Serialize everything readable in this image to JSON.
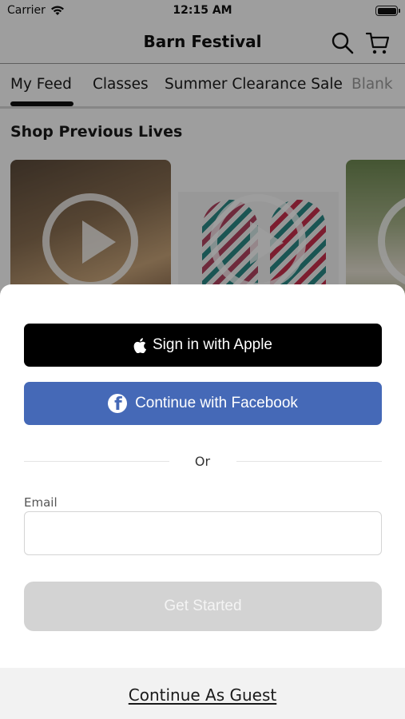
{
  "status_bar": {
    "carrier": "Carrier",
    "time": "12:15 AM",
    "battery_level": 1.0
  },
  "header": {
    "title": "Barn Festival",
    "icons": [
      "search-icon",
      "cart-icon"
    ]
  },
  "tabs": [
    {
      "label": "My Feed",
      "selected": true
    },
    {
      "label": "Classes",
      "selected": false
    },
    {
      "label": "Summer Clearance Sale",
      "selected": false
    },
    {
      "label": "Blank",
      "selected": false
    }
  ],
  "section": {
    "title": "Shop Previous Lives"
  },
  "sheet": {
    "apple_button": {
      "label": "Sign in with Apple",
      "icon": "apple-icon"
    },
    "facebook_button": {
      "label": "Continue with Facebook",
      "icon": "facebook-icon"
    },
    "divider_text": "Or",
    "email": {
      "label": "Email",
      "value": "",
      "placeholder": ""
    },
    "get_started_button": {
      "label": "Get Started"
    },
    "guest_link": {
      "label": "Continue As Guest"
    }
  },
  "colors": {
    "facebook_blue": "#4569b7",
    "apple_black": "#000000",
    "disabled_gray": "#d3d3d3"
  }
}
